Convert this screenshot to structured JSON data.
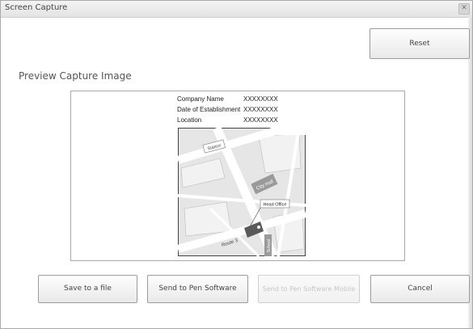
{
  "window": {
    "title": "Screen Capture"
  },
  "toolbar": {
    "reset_label": "Reset"
  },
  "preview": {
    "heading": "Preview Capture Image",
    "info_rows": [
      {
        "label": "Company Name",
        "value": "XXXXXXXX"
      },
      {
        "label": "Date of Establishment",
        "value": "XXXXXXXX"
      },
      {
        "label": "Location",
        "value": "XXXXXXXX"
      }
    ],
    "map": {
      "labels": {
        "station": "Station",
        "city_hall": "City Hall",
        "head_office": "Head Office",
        "route": "Route 3",
        "school": "School"
      }
    }
  },
  "actions": {
    "save_label": "Save to a file",
    "send_pen_label": "Send to Pen Software",
    "send_mobile_label": "Send to Pen Software Mobile",
    "cancel_label": "Cancel"
  },
  "colors": {
    "map_road": "#ffffff",
    "map_bg": "#e6e6e6",
    "map_building": "#9a9a9a",
    "office": "#5a5a5a"
  }
}
